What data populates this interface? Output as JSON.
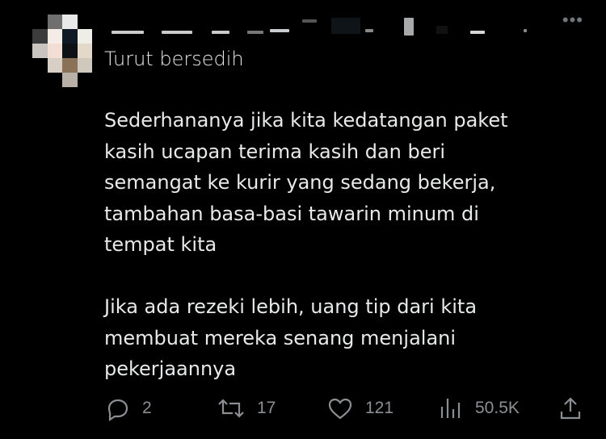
{
  "post": {
    "more_icon": "more-horizontal-icon",
    "reply_text": "Turut bersedih",
    "paragraphs": [
      "Sederhananya jika kita kedatangan paket\nkasih ucapan terima kasih dan beri\nsemangat ke kurir yang sedang bekerja,\ntambahan basa-basi tawarin minum di\ntempat kita",
      "Jika ada rezeki lebih, uang tip dari kita\nmembuat mereka senang menjalani\npekerjaannya"
    ]
  },
  "actions": {
    "replies": "2",
    "reposts": "17",
    "likes": "121",
    "views": "50.5K"
  },
  "colors": {
    "background": "#000000",
    "text": "#e7e9ea",
    "muted": "#8b8f94"
  }
}
